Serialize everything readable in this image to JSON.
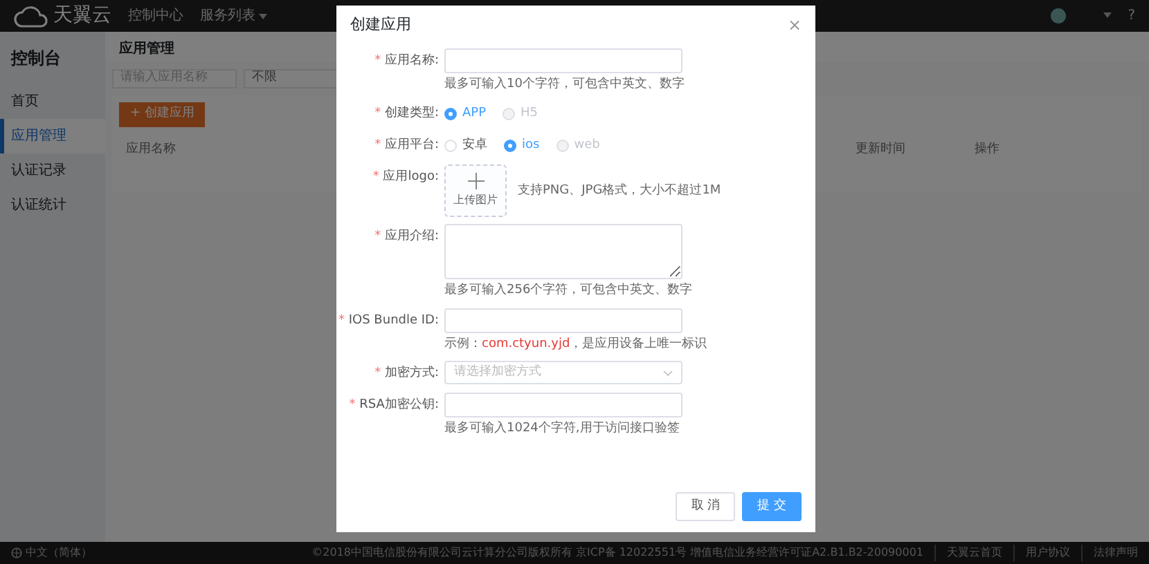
{
  "header": {
    "logo_text": "天翼云",
    "nav": [
      {
        "label": "控制中心"
      },
      {
        "label": "服务列表"
      }
    ],
    "help": "?"
  },
  "sidebar": {
    "title": "控制台",
    "items": [
      {
        "label": "首页",
        "selected": false
      },
      {
        "label": "应用管理",
        "selected": true
      },
      {
        "label": "认证记录",
        "selected": false
      },
      {
        "label": "认证统计",
        "selected": false
      }
    ]
  },
  "main": {
    "title": "应用管理",
    "search": {
      "placeholder": "请输入应用名称"
    },
    "filter": {
      "value": "不限"
    },
    "create_button": "+ 创建应用",
    "table": {
      "columns": [
        "应用名称",
        "更新时间",
        "操作"
      ]
    }
  },
  "modal": {
    "title": "创建应用",
    "close": "×",
    "fields": [
      {
        "kind": "text",
        "marker": "*",
        "label": "应用名称:",
        "hint": [
          {
            "text": "最多可输入10个字符，可包含中英文、数字",
            "highlight": false
          }
        ]
      },
      {
        "kind": "radio",
        "marker": "*",
        "label": "创建类型:",
        "options": [
          {
            "label": "APP",
            "selected": true,
            "disabled": false
          },
          {
            "label": "H5",
            "selected": false,
            "disabled": true
          }
        ]
      },
      {
        "kind": "radio",
        "marker": "*",
        "label": "应用平台:",
        "options": [
          {
            "label": "安卓",
            "selected": false,
            "disabled": false
          },
          {
            "label": "ios",
            "selected": true,
            "disabled": false
          },
          {
            "label": "web",
            "selected": false,
            "disabled": true
          }
        ]
      },
      {
        "kind": "upload",
        "marker": "*",
        "label": "应用logo:",
        "button": "上传图片",
        "note": "支持PNG、JPG格式，大小不超过1M"
      },
      {
        "kind": "textarea",
        "marker": "*",
        "label": "应用介绍:",
        "hint": [
          {
            "text": "最多可输入256个字符，可包含中英文、数字",
            "highlight": false
          }
        ]
      },
      {
        "kind": "text",
        "marker": "*",
        "label": "IOS Bundle ID:",
        "hint": [
          {
            "text": "示例：",
            "highlight": false
          },
          {
            "text": "com.ctyun.yjd",
            "highlight": true
          },
          {
            "text": "，是应用设备上唯一标识",
            "highlight": false
          }
        ]
      },
      {
        "kind": "select",
        "marker": "*",
        "label": "加密方式:",
        "placeholder": "请选择加密方式"
      },
      {
        "kind": "text",
        "marker": "*",
        "label": "RSA加密公钥:",
        "hint": [
          {
            "text": "最多可输入1024个字符,用于访问接口验签",
            "highlight": false
          }
        ]
      }
    ],
    "buttons": [
      {
        "label": "取 消",
        "primary": false
      },
      {
        "label": "提 交",
        "primary": true
      }
    ]
  },
  "footer": {
    "language": "中文（简体）",
    "copyright": "©2018中国电信股份有限公司云计算分公司版权所有 京ICP备 12022551号 增值电信业务经营许可证A2.B1.B2-20090001",
    "links": [
      "天翼云首页",
      "用户协议",
      "法律声明"
    ]
  }
}
